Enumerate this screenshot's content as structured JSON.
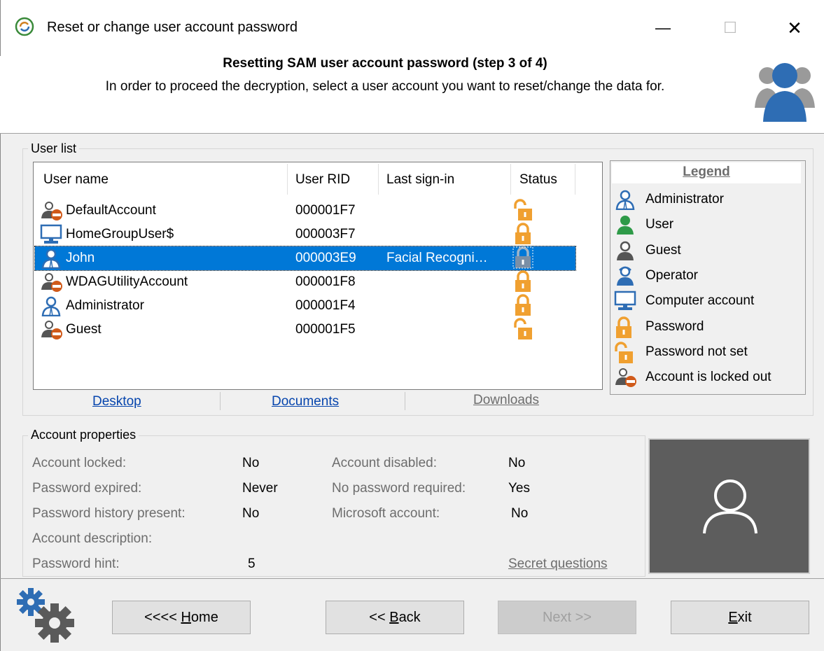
{
  "window": {
    "title": "Reset or change user account password",
    "minimize_glyph": "—",
    "maximize_glyph": "☐",
    "close_glyph": "✕"
  },
  "header": {
    "title": "Resetting SAM user account password (step 3 of 4)",
    "subtitle": "In order to proceed the decryption, select a user account you want to reset/change the data for.",
    "icon": "users-group-icon"
  },
  "user_list": {
    "group_label": "User list",
    "columns": [
      "User name",
      "User RID",
      "Last sign-in",
      "Status"
    ],
    "rows": [
      {
        "name": "DefaultAccount",
        "rid": "000001F7",
        "last_signin": "",
        "type": "locked-out",
        "status": "password-not-set",
        "selected": false
      },
      {
        "name": "HomeGroupUser$",
        "rid": "000003F7",
        "last_signin": "",
        "type": "computer",
        "status": "password",
        "selected": false
      },
      {
        "name": "John",
        "rid": "000003E9",
        "last_signin": "Facial Recogni…",
        "type": "administrator",
        "status": "password",
        "selected": true
      },
      {
        "name": "WDAGUtilityAccount",
        "rid": "000001F8",
        "last_signin": "",
        "type": "locked-out",
        "status": "password",
        "selected": false
      },
      {
        "name": "Administrator",
        "rid": "000001F4",
        "last_signin": "",
        "type": "administrator",
        "status": "password",
        "selected": false
      },
      {
        "name": "Guest",
        "rid": "000001F5",
        "last_signin": "",
        "type": "locked-out",
        "status": "password-not-set",
        "selected": false
      }
    ]
  },
  "folders": {
    "desktop": "Desktop",
    "documents": "Documents",
    "downloads": "Downloads"
  },
  "legend": {
    "title": "Legend",
    "items": [
      {
        "label": "Administrator",
        "icon": "administrator-icon"
      },
      {
        "label": "User",
        "icon": "user-icon"
      },
      {
        "label": "Guest",
        "icon": "guest-icon"
      },
      {
        "label": "Operator",
        "icon": "operator-icon"
      },
      {
        "label": "Computer account",
        "icon": "computer-account-icon"
      },
      {
        "label": "Password",
        "icon": "password-lock-icon"
      },
      {
        "label": "Password not set",
        "icon": "password-not-set-icon"
      },
      {
        "label": "Account is locked out",
        "icon": "account-locked-out-icon"
      }
    ]
  },
  "account_properties": {
    "group_label": "Account properties",
    "account_locked_label": "Account locked:",
    "account_locked": "No",
    "password_expired_label": "Password expired:",
    "password_expired": "Never",
    "password_history_label": "Password history present:",
    "password_history": "No",
    "account_description_label": "Account description:",
    "account_description": "",
    "password_hint_label": "Password hint:",
    "password_hint": "5",
    "account_disabled_label": "Account disabled:",
    "account_disabled": "No",
    "no_password_required_label": "No password required:",
    "no_password_required": "Yes",
    "microsoft_account_label": "Microsoft account:",
    "microsoft_account": "No",
    "secret_questions_link": "Secret questions"
  },
  "buttons": {
    "home_prefix": "<<<< ",
    "home_key": "H",
    "home_rest": "ome",
    "back_prefix": "<< ",
    "back_key": "B",
    "back_rest": "ack",
    "next": "Next >>",
    "exit_key": "E",
    "exit_rest": "xit"
  },
  "colors": {
    "selection": "#0078d7",
    "lock_orange": "#f0a030",
    "link_blue": "#0645ad",
    "avatar_bg": "#5d5d5d",
    "admin_blue": "#2e6db4",
    "user_green": "#2e9a48"
  }
}
